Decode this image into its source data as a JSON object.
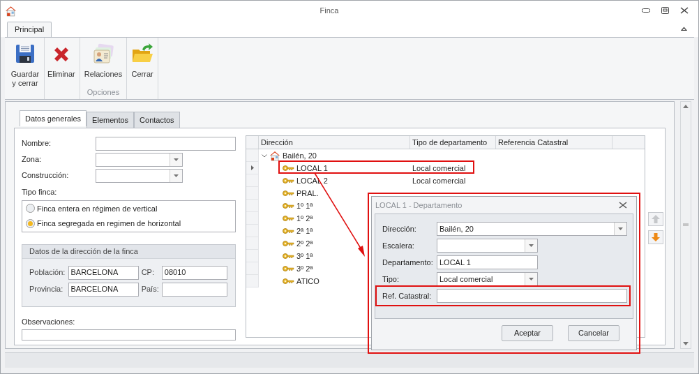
{
  "window": {
    "title": "Finca"
  },
  "ribbon": {
    "tabs": [
      {
        "label": "Principal",
        "selected": true
      }
    ],
    "groups": [
      {
        "buttons": [
          {
            "label": "Guardar y cerrar"
          },
          {
            "label": "Eliminar"
          }
        ]
      },
      {
        "label": "Opciones",
        "buttons": [
          {
            "label": "Relaciones"
          }
        ]
      },
      {
        "buttons": [
          {
            "label": "Cerrar"
          }
        ]
      }
    ]
  },
  "tabs": [
    {
      "label": "Datos generales",
      "selected": true
    },
    {
      "label": "Elementos",
      "selected": false
    },
    {
      "label": "Contactos",
      "selected": false
    }
  ],
  "form": {
    "fields": [
      {
        "label": "Nombre:",
        "kind": "text"
      },
      {
        "label": "Zona:",
        "kind": "combo"
      },
      {
        "label": "Construcción:",
        "kind": "combo"
      }
    ],
    "tipo_finca": {
      "label": "Tipo finca:",
      "options": [
        {
          "label": "Finca entera en régimen de vertical",
          "selected": false
        },
        {
          "label": "Finca segregada en regimen de horizontal",
          "selected": true
        }
      ]
    },
    "address": {
      "title": "Datos de la dirección de la finca",
      "fields": [
        {
          "label": "Población:",
          "value": "BARCELONA"
        },
        {
          "label": "CP:",
          "value": "08010"
        },
        {
          "label": "Provincia:",
          "value": "BARCELONA"
        },
        {
          "label": "País:"
        }
      ]
    },
    "observaciones": {
      "label": "Observaciones:"
    }
  },
  "grid": {
    "columns": [
      "Dirección",
      "Tipo de departamento",
      "Referencia Catastral"
    ],
    "root": {
      "label": "Bailén, 20",
      "expanded": true,
      "children": [
        {
          "label": "LOCAL 1",
          "tipo": "Local comercial",
          "selected": true
        },
        {
          "label": "LOCAL 2",
          "tipo": "Local comercial",
          "selected": false
        },
        {
          "label": "PRAL.",
          "selected": false
        },
        {
          "label": "1º 1ª",
          "selected": false
        },
        {
          "label": "1º 2ª",
          "selected": false
        },
        {
          "label": "2ª 1ª",
          "selected": false
        },
        {
          "label": "2º 2ª",
          "selected": false
        },
        {
          "label": "3º 1ª",
          "selected": false
        },
        {
          "label": "3º 2ª",
          "selected": false
        },
        {
          "label": "ATICO",
          "selected": false
        }
      ]
    }
  },
  "dialog": {
    "title": "LOCAL 1 - Departamento",
    "fields": [
      {
        "label": "Dirección:",
        "kind": "combo",
        "value": "Bailén, 20"
      },
      {
        "label": "Escalera:",
        "kind": "combo"
      },
      {
        "label": "Departamento:",
        "kind": "text",
        "value": "LOCAL 1"
      },
      {
        "label": "Tipo:",
        "kind": "combo",
        "value": "Local comercial"
      },
      {
        "label": "Ref. Catastral:",
        "kind": "text"
      }
    ],
    "buttons": [
      "Aceptar",
      "Cancelar"
    ]
  }
}
